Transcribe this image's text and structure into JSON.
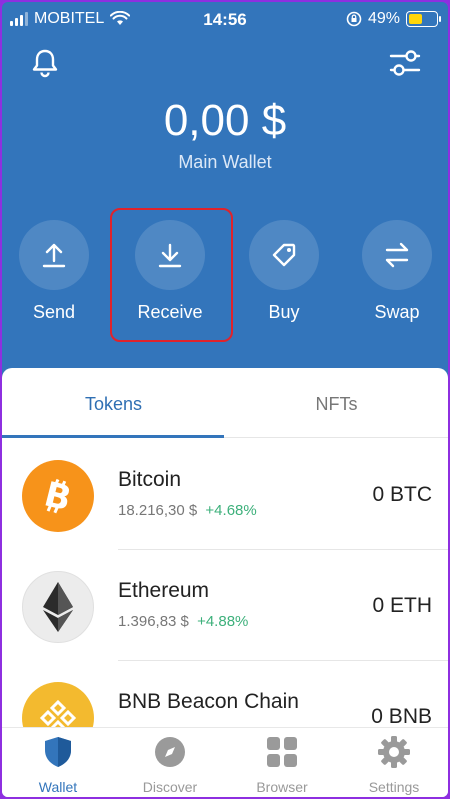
{
  "status": {
    "carrier": "MOBITEL",
    "time": "14:56",
    "battery": "49%",
    "battery_level": 0.49
  },
  "header": {
    "balance": "0,00 $",
    "wallet_name": "Main Wallet"
  },
  "actions": [
    {
      "label": "Send",
      "icon": "upload-icon"
    },
    {
      "label": "Receive",
      "icon": "download-icon"
    },
    {
      "label": "Buy",
      "icon": "tag-icon"
    },
    {
      "label": "Swap",
      "icon": "swap-arrows-icon"
    }
  ],
  "tabs": {
    "tokens": "Tokens",
    "nfts": "NFTs"
  },
  "tokens": [
    {
      "name": "Bitcoin",
      "price": "18.216,30 $",
      "change": "+4.68%",
      "balance": "0 BTC",
      "color": "#f7931a"
    },
    {
      "name": "Ethereum",
      "price": "1.396,83 $",
      "change": "+4.88%",
      "balance": "0 ETH",
      "color": "#ececec"
    },
    {
      "name": "BNB Beacon Chain",
      "price": "",
      "change": "",
      "balance": "0 BNB",
      "color": "#f3ba2f"
    }
  ],
  "nav": [
    {
      "label": "Wallet",
      "icon": "shield-icon"
    },
    {
      "label": "Discover",
      "icon": "compass-icon"
    },
    {
      "label": "Browser",
      "icon": "grid-icon"
    },
    {
      "label": "Settings",
      "icon": "gear-icon"
    }
  ],
  "colors": {
    "brand": "#3375bb",
    "positive": "#3db07b",
    "highlight": "#e0232b"
  }
}
